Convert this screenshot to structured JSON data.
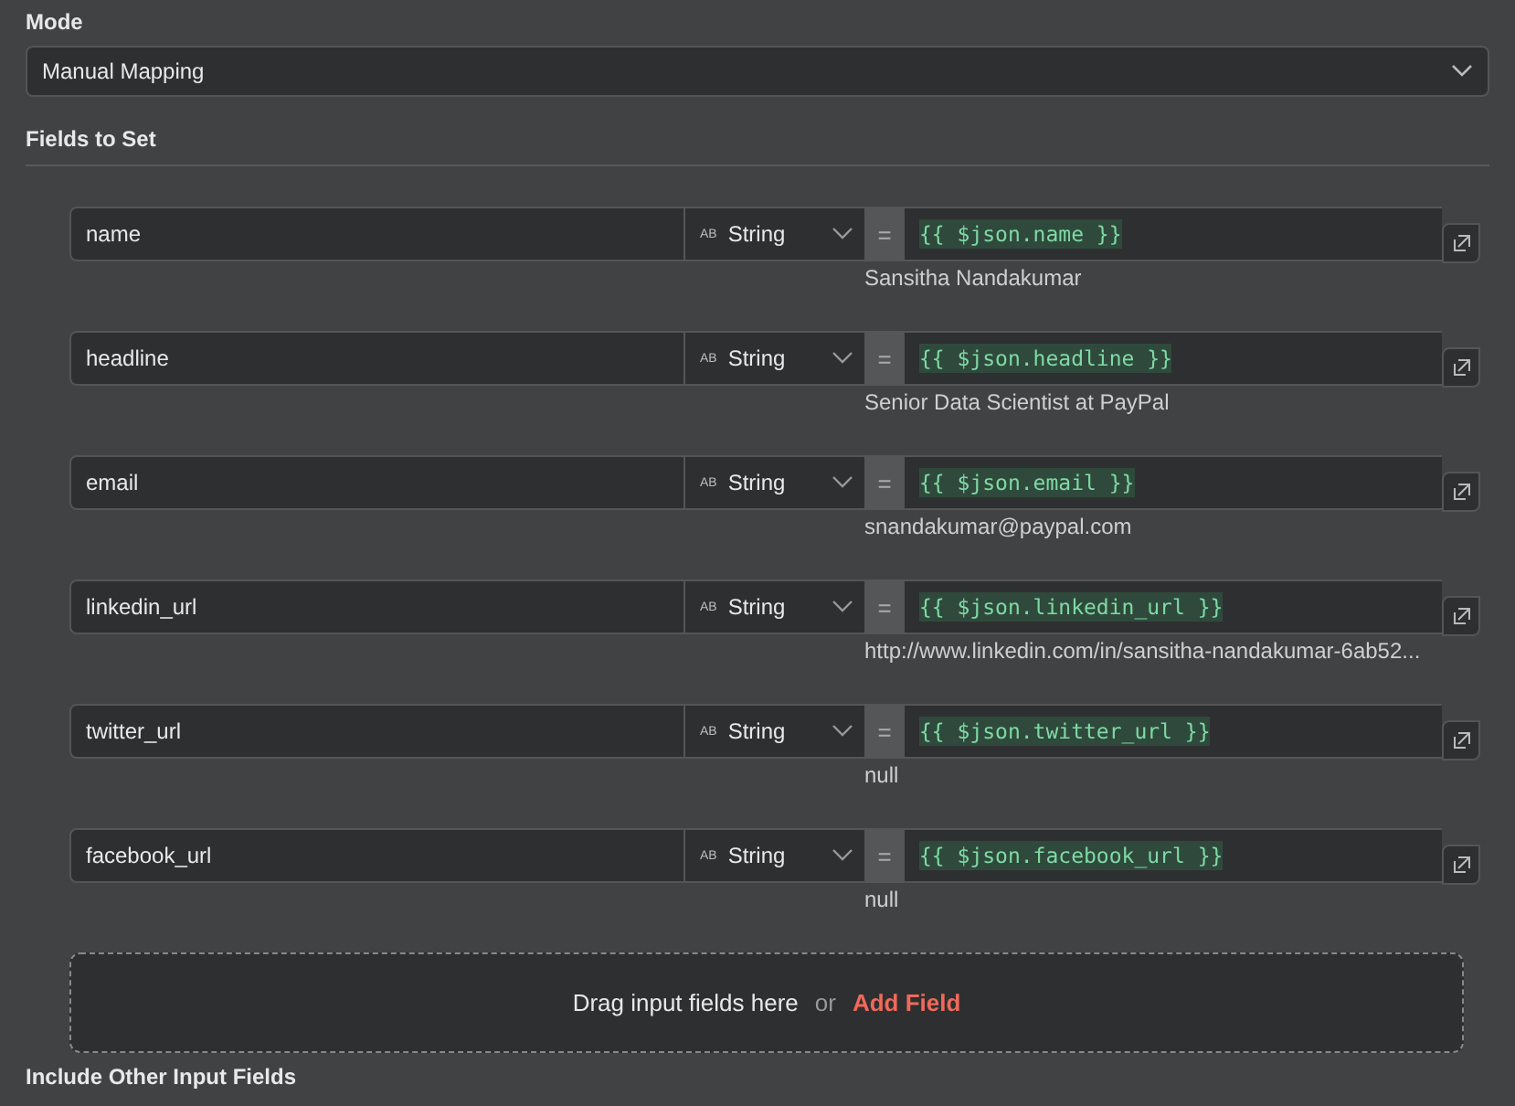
{
  "mode": {
    "label": "Mode",
    "value": "Manual Mapping"
  },
  "fields_section": {
    "title": "Fields to Set"
  },
  "fields": [
    {
      "name": "name",
      "type_badge": "AB",
      "type": "String",
      "equals": "=",
      "expression": "{{ $json.name }}",
      "preview": "Sansitha Nandakumar"
    },
    {
      "name": "headline",
      "type_badge": "AB",
      "type": "String",
      "equals": "=",
      "expression": "{{ $json.headline }}",
      "preview": "Senior Data Scientist at PayPal"
    },
    {
      "name": "email",
      "type_badge": "AB",
      "type": "String",
      "equals": "=",
      "expression": "{{ $json.email }}",
      "preview": "snandakumar@paypal.com"
    },
    {
      "name": "linkedin_url",
      "type_badge": "AB",
      "type": "String",
      "equals": "=",
      "expression": "{{ $json.linkedin_url }}",
      "preview": "http://www.linkedin.com/in/sansitha-nandakumar-6ab52..."
    },
    {
      "name": "twitter_url",
      "type_badge": "AB",
      "type": "String",
      "equals": "=",
      "expression": "{{ $json.twitter_url }}",
      "preview": "null"
    },
    {
      "name": "facebook_url",
      "type_badge": "AB",
      "type": "String",
      "equals": "=",
      "expression": "{{ $json.facebook_url }}",
      "preview": "null"
    }
  ],
  "drop_zone": {
    "text": "Drag input fields here",
    "or": "or",
    "link": "Add Field"
  },
  "next_section": {
    "title": "Include Other Input Fields"
  }
}
